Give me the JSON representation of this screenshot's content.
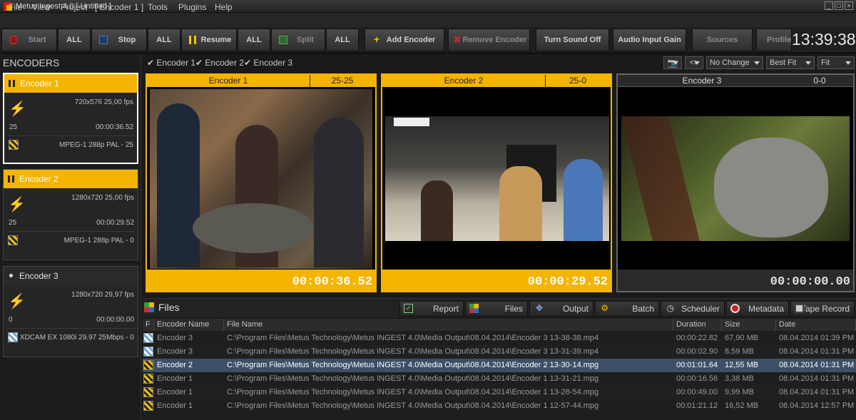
{
  "window": {
    "title": "Metus Ingest 4.0 [ Untitled ]"
  },
  "menu": [
    "File",
    "View",
    "Project",
    "[ Encoder 1 ]",
    "Tools",
    "Plugins",
    "Help"
  ],
  "toolbar": {
    "start": "Start",
    "stop": "Stop",
    "resume": "Resume",
    "split": "Split",
    "all": "ALL",
    "add_encoder": "Add Encoder",
    "remove_encoder": "Remove Encoder",
    "turn_sound_off": "Turn Sound Off",
    "audio_input_gain": "Audio Input Gain",
    "sources": "Sources",
    "profile": "Profile",
    "clock": "13:39:38"
  },
  "sidebar": {
    "title": "ENCODERS",
    "encoders": [
      {
        "name": "Encoder 1",
        "resolution": "720x576 25,00 fps",
        "level": "25",
        "time": "00:00:36.52",
        "format": "MPEG-1 288p PAL - 25"
      },
      {
        "name": "Encoder 2",
        "resolution": "1280x720 25,00 fps",
        "level": "25",
        "time": "00:00:29.52",
        "format": "MPEG-1 288p PAL - 0"
      },
      {
        "name": "Encoder 3",
        "resolution": "1280x720 29,97 fps",
        "level": "0",
        "time": "00:00:00.00",
        "format": "XDCAM EX 1080i 29.97 25Mbps - 0"
      }
    ]
  },
  "view": {
    "checks": [
      "Encoder 1",
      "Encoder 2",
      "Encoder 3"
    ],
    "arrows": "<>",
    "mode": "No Change",
    "fit1": "Best Fit",
    "fit2": "Fit"
  },
  "panels": [
    {
      "name": "Encoder 1",
      "counter": "25-25",
      "timecode": "00:00:36.52"
    },
    {
      "name": "Encoder 2",
      "counter": "25-0",
      "timecode": "00:00:29.52"
    },
    {
      "name": "Encoder 3",
      "counter": "0-0",
      "timecode": "00:00:00.00"
    }
  ],
  "files": {
    "title": "Files",
    "tabs": [
      "Report",
      "Files",
      "Output",
      "Batch",
      "Scheduler",
      "Metadata",
      "Tape Record"
    ],
    "columns": [
      "F",
      "Encoder Name",
      "File Name",
      "Duration",
      "Size",
      "Date"
    ],
    "rows": [
      {
        "encoder": "Encoder 3",
        "file": "C:\\Program Files\\Metus Technology\\Metus INGEST 4.0\\Media Output\\08.04.2014\\Encoder 3 13-38-38.mp4",
        "duration": "00:00:22.82",
        "size": "67,90 MB",
        "date": "08.04.2014 01:39 PM"
      },
      {
        "encoder": "Encoder 3",
        "file": "C:\\Program Files\\Metus Technology\\Metus INGEST 4.0\\Media Output\\08.04.2014\\Encoder 3 13-31-39.mp4",
        "duration": "00:00:02.90",
        "size": "8,59 MB",
        "date": "08.04.2014 01:31 PM"
      },
      {
        "encoder": "Encoder 2",
        "file": "C:\\Program Files\\Metus Technology\\Metus INGEST 4.0\\Media Output\\08.04.2014\\Encoder 2 13-30-14.mpg",
        "duration": "00:01:01.64",
        "size": "12,55 MB",
        "date": "08.04.2014 01:31 PM"
      },
      {
        "encoder": "Encoder 1",
        "file": "C:\\Program Files\\Metus Technology\\Metus INGEST 4.0\\Media Output\\08.04.2014\\Encoder 1 13-31-21.mpg",
        "duration": "00:00:16.56",
        "size": "3,38 MB",
        "date": "08.04.2014 01:31 PM"
      },
      {
        "encoder": "Encoder 1",
        "file": "C:\\Program Files\\Metus Technology\\Metus INGEST 4.0\\Media Output\\08.04.2014\\Encoder 1 13-28-54.mpg",
        "duration": "00:00:49.00",
        "size": "9,99 MB",
        "date": "08.04.2014 01:31 PM"
      },
      {
        "encoder": "Encoder 1",
        "file": "C:\\Program Files\\Metus Technology\\Metus INGEST 4.0\\Media Output\\08.04.2014\\Encoder 1 12-57-44.mpg",
        "duration": "00:01:21.12",
        "size": "16,52 MB",
        "date": "08.04.2014 12:57 PM"
      }
    ]
  },
  "colors": {
    "accent": "#f5b400",
    "selection": "#3d4f66"
  }
}
